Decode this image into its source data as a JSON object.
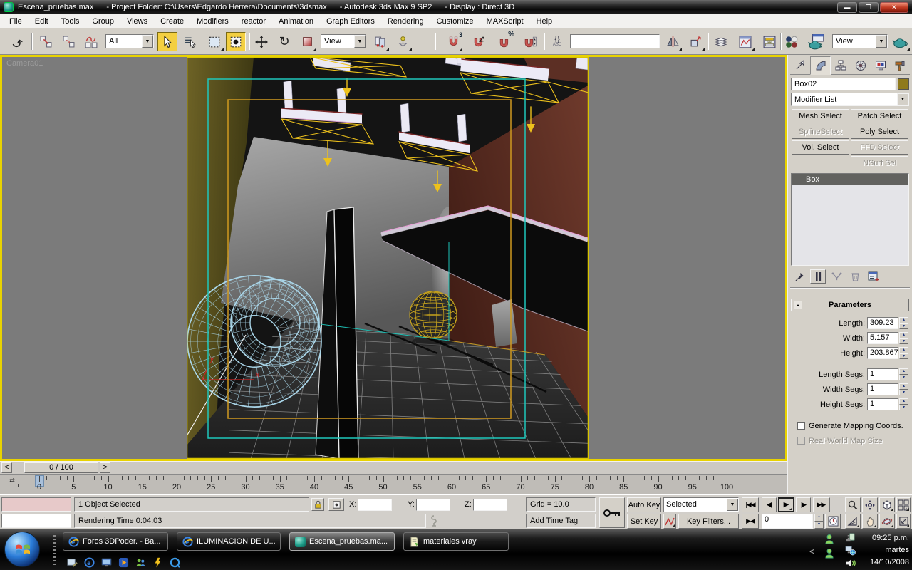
{
  "window": {
    "title_file": "Escena_pruebas.max",
    "title_project": "- Project Folder: C:\\Users\\Edgardo Herrera\\Documents\\3dsmax",
    "title_app": "- Autodesk 3ds Max 9 SP2",
    "title_display": "- Display : Direct 3D"
  },
  "menu": {
    "items": [
      "File",
      "Edit",
      "Tools",
      "Group",
      "Views",
      "Create",
      "Modifiers",
      "reactor",
      "Animation",
      "Graph Editors",
      "Rendering",
      "Customize",
      "MAXScript",
      "Help"
    ]
  },
  "toolbar": {
    "selection_filter": "All",
    "ref_coord": "View",
    "render_type": "View",
    "named_selection": ""
  },
  "viewport": {
    "camera_label": "Camera01",
    "axis_x": "x",
    "axis_y": "y"
  },
  "panel": {
    "object_name": "Box02",
    "object_color": "#8f7a1c",
    "modifier_list": "Modifier List",
    "modifier_buttons": [
      {
        "label": "Mesh Select"
      },
      {
        "label": "Patch Select"
      },
      {
        "label": "SplineSelect"
      },
      {
        "label": "Poly Select"
      },
      {
        "label": "Vol. Select"
      },
      {
        "label": "FFD Select"
      },
      {
        "label": ""
      },
      {
        "label": "NSurf Sel"
      }
    ],
    "stack": [
      "Box"
    ],
    "rollout_title": "Parameters",
    "params": [
      {
        "label": "Length:",
        "value": "309.23"
      },
      {
        "label": "Width:",
        "value": "5.157"
      },
      {
        "label": "Height:",
        "value": "203.867"
      },
      {
        "label": "Length Segs:",
        "value": "1"
      },
      {
        "label": "Width Segs:",
        "value": "1"
      },
      {
        "label": "Height Segs:",
        "value": "1"
      }
    ],
    "check1": "Generate Mapping Coords.",
    "check2": "Real-World Map Size"
  },
  "timeline": {
    "slider_value": "0 / 100",
    "labels": [
      "0",
      "5",
      "10",
      "15",
      "20",
      "25",
      "30",
      "35",
      "40",
      "45",
      "50",
      "55",
      "60",
      "65",
      "70",
      "75",
      "80",
      "85",
      "90",
      "95",
      "100"
    ]
  },
  "status": {
    "selection": "1 Object Selected",
    "prompt": "Rendering Time 0:04:03",
    "grid": "Grid = 10.0",
    "add_time_tag": "Add Time Tag",
    "auto_key": "Auto Key",
    "set_key": "Set Key",
    "key_filters": "Key Filters...",
    "selected_combo": "Selected",
    "x_label": "X:",
    "y_label": "Y:",
    "z_label": "Z:",
    "x": "",
    "y": "",
    "z": "",
    "frame": "0"
  },
  "taskbar": {
    "tasks": [
      {
        "label": "Foros 3DPoder. - Ba..."
      },
      {
        "label": "ILUMINACION DE U..."
      },
      {
        "label": "Escena_pruebas.ma..."
      },
      {
        "label": "materiales vray"
      }
    ],
    "clock_time": "09:25 p.m.",
    "clock_day": "martes",
    "clock_date": "14/10/2008"
  },
  "icons": {
    "dropdown": "▼",
    "spin_up": "▴",
    "spin_down": "▾",
    "go_start": "|◀◀",
    "prev_frame": "◀|",
    "play": "▶",
    "next_frame": "|▶",
    "go_end": "▶▶|",
    "key_mode": "▶◀",
    "left_arrow": "<",
    "right_arrow": ">",
    "tray_chevron": "<",
    "minus": "-",
    "snap_3": "3",
    "snap_pct": "%",
    "braces": "{}",
    "abc": "ABC",
    "undo_arrow": "↷",
    "rotate_arrow": "↻",
    "trackbar_glyph": "⇄"
  }
}
